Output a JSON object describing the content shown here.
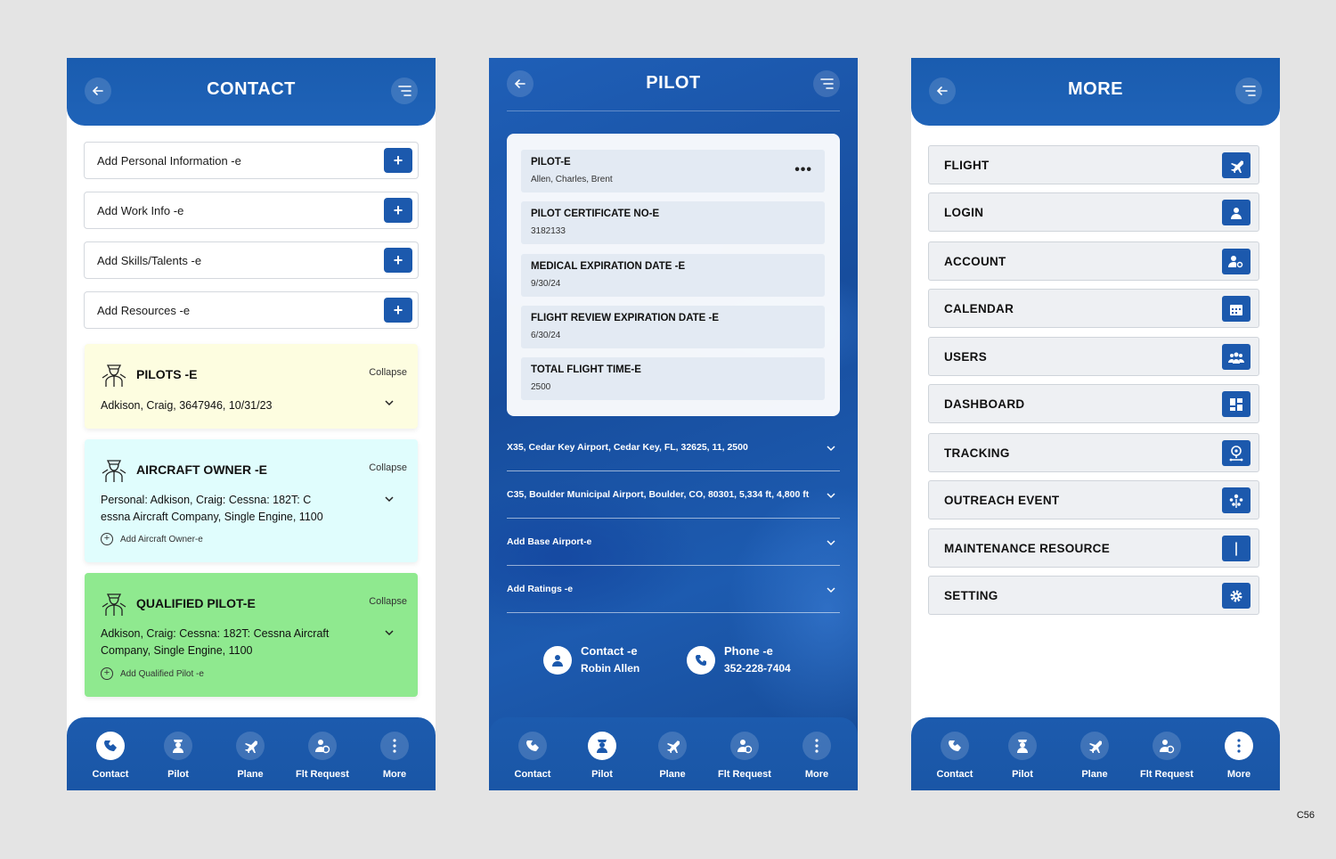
{
  "contact_screen": {
    "title": "CONTACT",
    "add_rows": [
      {
        "label": "Add Personal Information -e"
      },
      {
        "label": "Add Work Info -e"
      },
      {
        "label": "Add Skills/Talents -e"
      },
      {
        "label": "Add Resources -e"
      }
    ],
    "cards": [
      {
        "title": "PILOTS -E",
        "collapse": "Collapse",
        "body": "Adkison, Craig, 3647946, 10/31/23",
        "color": "#fdfde0"
      },
      {
        "title": "AIRCRAFT OWNER -E",
        "collapse": "Collapse",
        "body": "Personal: Adkison, Craig: Cessna: 182T: C essna Aircraft Company, Single Engine, 1100",
        "add": "Add Aircraft Owner-e",
        "color": "#e0fdfd"
      },
      {
        "title": "QUALIFIED PILOT-E",
        "collapse": "Collapse",
        "body": "Adkison, Craig: Cessna: 182T: Cessna Aircraft Company, Single Engine, 1100",
        "add": "Add Qualified Pilot -e",
        "color": "#8fe98f"
      }
    ]
  },
  "pilot_screen": {
    "title": "PILOT",
    "fields": [
      {
        "label": "PILOT-E",
        "value": "Allen, Charles, Brent"
      },
      {
        "label": "PILOT CERTIFICATE NO-E",
        "value": "3182133"
      },
      {
        "label": "MEDICAL EXPIRATION DATE -E",
        "value": "9/30/24"
      },
      {
        "label": "FLIGHT REVIEW EXPIRATION DATE -E",
        "value": "6/30/24"
      },
      {
        "label": "TOTAL FLIGHT TIME-E",
        "value": "2500"
      }
    ],
    "rows": [
      {
        "label": "X35, Cedar Key Airport, Cedar Key, FL, 32625, 11, 2500"
      },
      {
        "label": "C35, Boulder Municipal Airport, Boulder, CO, 80301, 5,334 ft, 4,800 ft"
      },
      {
        "label": "Add Base Airport-e"
      },
      {
        "label": "Add Ratings -e"
      }
    ],
    "contact": {
      "title": "Contact -e",
      "value": "Robin Allen"
    },
    "phone": {
      "title": "Phone -e",
      "value": "352-228-7404"
    }
  },
  "more_screen": {
    "title": "MORE",
    "items": [
      {
        "label": "FLIGHT",
        "icon": "plane-icon"
      },
      {
        "label": "LOGIN",
        "icon": "user-icon"
      },
      {
        "label": "ACCOUNT",
        "icon": "user-gear-icon"
      },
      {
        "label": "CALENDAR",
        "icon": "calendar-icon"
      },
      {
        "label": "USERS",
        "icon": "users-icon"
      },
      {
        "label": "DASHBOARD",
        "icon": "dashboard-icon"
      },
      {
        "label": "TRACKING",
        "icon": "location-pin-icon"
      },
      {
        "label": "OUTREACH EVENT",
        "icon": "outreach-icon"
      },
      {
        "label": "MAINTENANCE RESOURCE",
        "icon": "wrench-icon"
      },
      {
        "label": "SETTING",
        "icon": "gear-icon"
      }
    ]
  },
  "nav": {
    "items": [
      "Contact",
      "Pilot",
      "Plane",
      "Flt Request",
      "More"
    ]
  },
  "corner_code": "C56",
  "colors": {
    "primary": "#1c59ad",
    "background": "#e4e4e4"
  }
}
